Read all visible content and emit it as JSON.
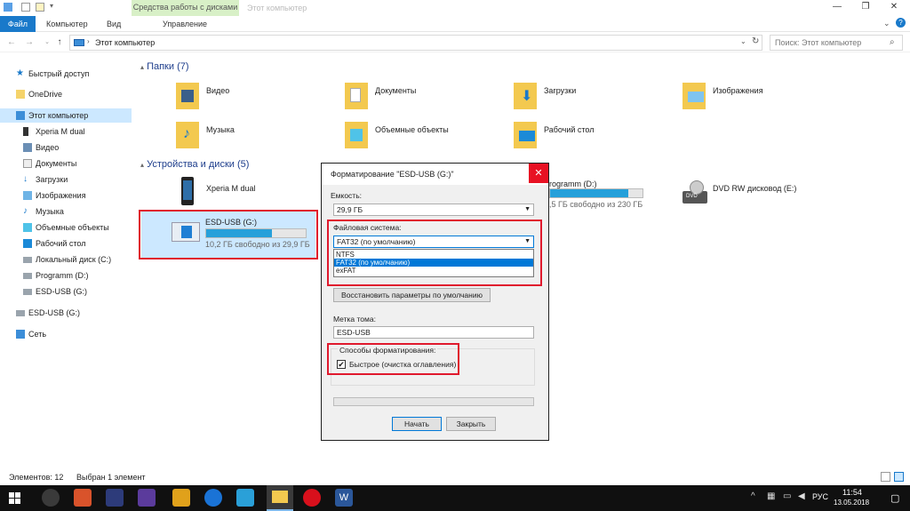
{
  "ribbon": {
    "tabs": [
      "Файл",
      "Компьютер",
      "Вид",
      "Управление"
    ],
    "context_group": "Средства работы с дисками",
    "window_title": "Этот компьютер"
  },
  "address": {
    "path": "Этот компьютер",
    "search_placeholder": "Поиск: Этот компьютер"
  },
  "sidebar": {
    "items": [
      {
        "label": "Быстрый доступ",
        "icon": "star-icon"
      },
      {
        "label": "OneDrive",
        "icon": "cloud-folder-icon"
      },
      {
        "label": "Этот компьютер",
        "icon": "computer-icon"
      },
      {
        "label": "Xperia M dual",
        "icon": "phone-icon"
      },
      {
        "label": "Видео",
        "icon": "video-folder-icon"
      },
      {
        "label": "Документы",
        "icon": "documents-folder-icon"
      },
      {
        "label": "Загрузки",
        "icon": "downloads-icon"
      },
      {
        "label": "Изображения",
        "icon": "pictures-icon"
      },
      {
        "label": "Музыка",
        "icon": "music-icon"
      },
      {
        "label": "Объемные объекты",
        "icon": "3d-objects-icon"
      },
      {
        "label": "Рабочий стол",
        "icon": "desktop-icon"
      },
      {
        "label": "Локальный диск (C:)",
        "icon": "drive-icon"
      },
      {
        "label": "Programm (D:)",
        "icon": "drive-icon"
      },
      {
        "label": "ESD-USB (G:)",
        "icon": "usb-drive-icon"
      },
      {
        "label": "ESD-USB (G:)",
        "icon": "usb-drive-icon"
      },
      {
        "label": "Сеть",
        "icon": "network-icon"
      }
    ]
  },
  "folders_section": {
    "title": "Папки (7)",
    "folders": [
      "Видео",
      "Документы",
      "Загрузки",
      "Изображения",
      "Музыка",
      "Объемные объекты",
      "Рабочий стол"
    ]
  },
  "devices_section": {
    "title": "Устройства и диски (5)",
    "xperia": "Xperia M dual",
    "esd_usb": {
      "name": "ESD-USB (G:)",
      "free": "10,2 ГБ свободно из 29,9 ГБ",
      "used_fraction": 0.66
    },
    "programm": {
      "name": "rogramm (D:)",
      "free": ",5 ГБ свободно из 230 ГБ",
      "used_fraction": 0.85
    },
    "dvd": {
      "name": "DVD RW дисковод (E:)"
    }
  },
  "dialog": {
    "title": "Форматирование \"ESD-USB (G:)\"",
    "close": "✕",
    "capacity_label": "Емкость:",
    "capacity_value": "29,9 ГБ",
    "fs_label": "Файловая система:",
    "fs_value": "FAT32 (по умолчанию)",
    "fs_options": [
      "NTFS",
      "FAT32 (по умолчанию)",
      "exFAT"
    ],
    "restore_button": "Восстановить параметры по умолчанию",
    "volume_label": "Метка тома:",
    "volume_value": "ESD-USB",
    "methods_label": "Способы форматирования:",
    "quick_format": "Быстрое (очистка оглавления)",
    "quick_checked": true,
    "start_button": "Начать",
    "close_button": "Закрыть"
  },
  "status": {
    "items_count": "Элементов: 12",
    "selected": "Выбран 1 элемент"
  },
  "taskbar": {
    "lang": "РУС",
    "time": "11:54",
    "date": "13.05.2018"
  },
  "colors": {
    "accent": "#1979ca",
    "highlight_red": "#e0192d",
    "progress": "#26a0da"
  }
}
